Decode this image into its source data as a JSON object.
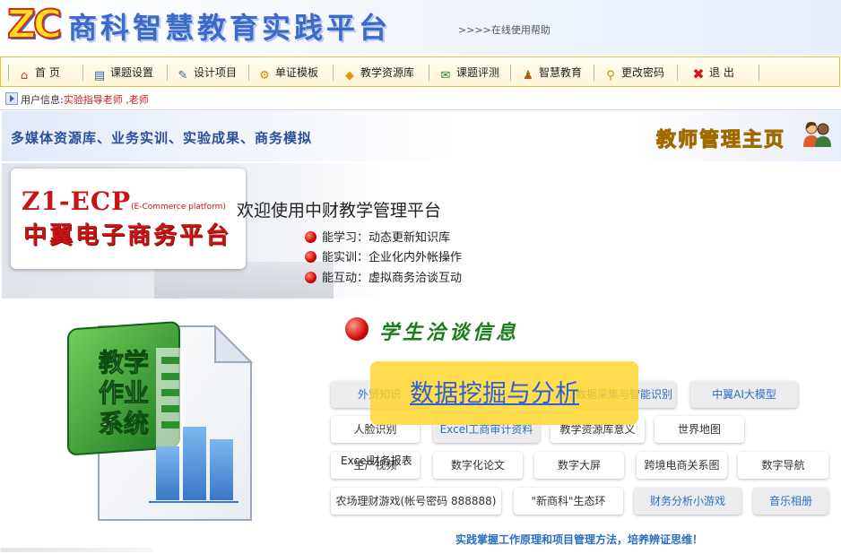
{
  "header": {
    "logo": "ZC",
    "title": "商科智慧教育实践平台",
    "help_link": ">>>>在线使用帮助"
  },
  "nav": {
    "items": [
      {
        "label": "首 页",
        "icon": "home-icon"
      },
      {
        "label": "课题设置",
        "icon": "document-icon"
      },
      {
        "label": "设计项目",
        "icon": "edit-icon"
      },
      {
        "label": "单证模板",
        "icon": "gear-icon"
      },
      {
        "label": "教学资源库",
        "icon": "lightbulb-icon"
      },
      {
        "label": "课题评测",
        "icon": "envelope-icon"
      },
      {
        "label": "智慧教育",
        "icon": "users-icon"
      },
      {
        "label": "更改密码",
        "icon": "key-icon"
      },
      {
        "label": "退 出",
        "icon": "close-icon"
      }
    ]
  },
  "user": {
    "label": "用户信息:",
    "value": "实验指导老师 ,老师"
  },
  "teacher_banner": {
    "left": "多媒体资源库、业务实训、实验成果、商务模拟",
    "right": "教师管理主页"
  },
  "hero": {
    "brand": "Z1-ECP",
    "brand_sub": "(E-Commerce platform)",
    "brand_cn": "中翼电子商务平台",
    "welcome": "欢迎使用中财教学管理平台",
    "lines": [
      "能学习：动态更新知识库",
      "能实训：企业化内外帐操作",
      "能互动：虚拟商务洽谈互动"
    ]
  },
  "edu_icon": {
    "text1": "教学",
    "text2": "作业",
    "text3": "系统"
  },
  "negotiation": {
    "title": "学生洽谈信息"
  },
  "chips": [
    {
      "label": "外贸知识"
    },
    {
      "label": "数据采集与智能识别"
    },
    {
      "label": "中翼AI大模型"
    },
    {
      "label": "人脸识别"
    },
    {
      "label": "Excel工商审计资料"
    },
    {
      "label": "教学资源库意义"
    },
    {
      "label": "世界地图"
    },
    {
      "label": "生产视频"
    },
    {
      "label": "数字化论文"
    },
    {
      "label": "数字大屏"
    },
    {
      "label": "跨境电商关系图"
    },
    {
      "label": "数字导航"
    },
    {
      "label": "农场理财游戏(帐号密码 888888)"
    },
    {
      "label": "\"新商科\"生态环"
    },
    {
      "label": "财务分析小游戏"
    },
    {
      "label": "音乐相册"
    }
  ],
  "overlay": {
    "label": "数据挖掘与分析"
  },
  "excel_report": "Excel财务报表",
  "footer": {
    "slogan": "实践掌握工作原理和项目管理方法，培养辨证思维！"
  },
  "colors": {
    "accent": "#2f6fc4",
    "red": "#c81414",
    "green": "#1a7d1a",
    "nav_border": "#e0c53a"
  }
}
